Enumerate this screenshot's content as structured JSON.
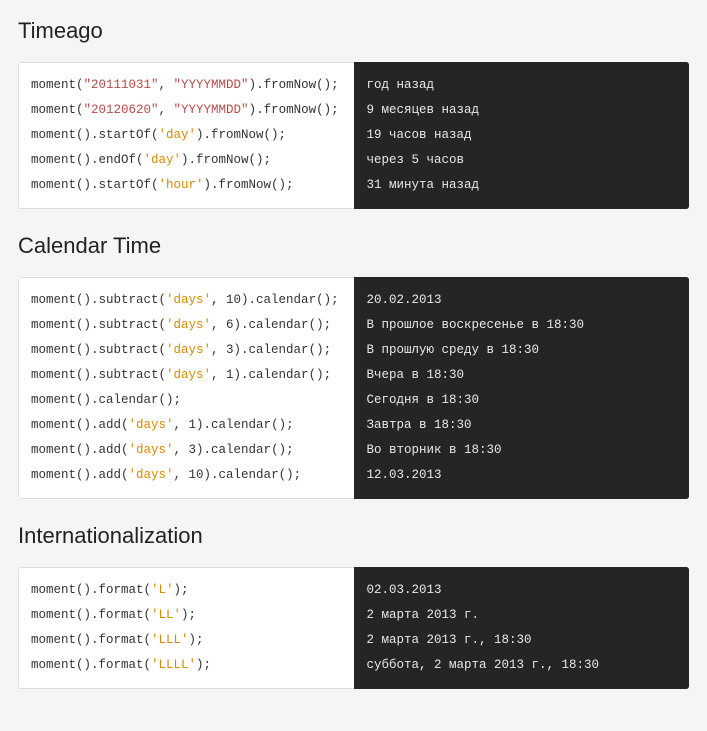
{
  "sections": [
    {
      "id": "timeago",
      "title": "Timeago",
      "rows": [
        {
          "code": [
            {
              "t": "plain",
              "v": "moment("
            },
            {
              "t": "str",
              "v": "\"20111031\""
            },
            {
              "t": "plain",
              "v": ", "
            },
            {
              "t": "str",
              "v": "\"YYYYMMDD\""
            },
            {
              "t": "plain",
              "v": ").fromNow();"
            }
          ],
          "out": "год назад"
        },
        {
          "code": [
            {
              "t": "plain",
              "v": "moment("
            },
            {
              "t": "str",
              "v": "\"20120620\""
            },
            {
              "t": "plain",
              "v": ", "
            },
            {
              "t": "str",
              "v": "\"YYYYMMDD\""
            },
            {
              "t": "plain",
              "v": ").fromNow();"
            }
          ],
          "out": "9 месяцев назад"
        },
        {
          "code": [
            {
              "t": "plain",
              "v": "moment().startOf("
            },
            {
              "t": "lit",
              "v": "'day'"
            },
            {
              "t": "plain",
              "v": ").fromNow();"
            }
          ],
          "out": "19 часов назад"
        },
        {
          "code": [
            {
              "t": "plain",
              "v": "moment().endOf("
            },
            {
              "t": "lit",
              "v": "'day'"
            },
            {
              "t": "plain",
              "v": ").fromNow();"
            }
          ],
          "out": "через 5 часов"
        },
        {
          "code": [
            {
              "t": "plain",
              "v": "moment().startOf("
            },
            {
              "t": "lit",
              "v": "'hour'"
            },
            {
              "t": "plain",
              "v": ").fromNow();"
            }
          ],
          "out": "31 минута назад"
        }
      ]
    },
    {
      "id": "calendar",
      "title": "Calendar Time",
      "rows": [
        {
          "code": [
            {
              "t": "plain",
              "v": "moment().subtract("
            },
            {
              "t": "lit",
              "v": "'days'"
            },
            {
              "t": "plain",
              "v": ", 10).calendar();"
            }
          ],
          "out": "20.02.2013"
        },
        {
          "code": [
            {
              "t": "plain",
              "v": "moment().subtract("
            },
            {
              "t": "lit",
              "v": "'days'"
            },
            {
              "t": "plain",
              "v": ", 6).calendar();"
            }
          ],
          "out": "В прошлое воскресенье в 18:30"
        },
        {
          "code": [
            {
              "t": "plain",
              "v": "moment().subtract("
            },
            {
              "t": "lit",
              "v": "'days'"
            },
            {
              "t": "plain",
              "v": ", 3).calendar();"
            }
          ],
          "out": "В прошлую среду в 18:30"
        },
        {
          "code": [
            {
              "t": "plain",
              "v": "moment().subtract("
            },
            {
              "t": "lit",
              "v": "'days'"
            },
            {
              "t": "plain",
              "v": ", 1).calendar();"
            }
          ],
          "out": "Вчера в 18:30"
        },
        {
          "code": [
            {
              "t": "plain",
              "v": "moment().calendar();"
            }
          ],
          "out": "Сегодня в 18:30"
        },
        {
          "code": [
            {
              "t": "plain",
              "v": "moment().add("
            },
            {
              "t": "lit",
              "v": "'days'"
            },
            {
              "t": "plain",
              "v": ", 1).calendar();"
            }
          ],
          "out": "Завтра в 18:30"
        },
        {
          "code": [
            {
              "t": "plain",
              "v": "moment().add("
            },
            {
              "t": "lit",
              "v": "'days'"
            },
            {
              "t": "plain",
              "v": ", 3).calendar();"
            }
          ],
          "out": "Во вторник в 18:30"
        },
        {
          "code": [
            {
              "t": "plain",
              "v": "moment().add("
            },
            {
              "t": "lit",
              "v": "'days'"
            },
            {
              "t": "plain",
              "v": ", 10).calendar();"
            }
          ],
          "out": "12.03.2013"
        }
      ]
    },
    {
      "id": "i18n",
      "title": "Internationalization",
      "rows": [
        {
          "code": [
            {
              "t": "plain",
              "v": "moment().format("
            },
            {
              "t": "lit",
              "v": "'L'"
            },
            {
              "t": "plain",
              "v": ");"
            }
          ],
          "out": "02.03.2013"
        },
        {
          "code": [
            {
              "t": "plain",
              "v": "moment().format("
            },
            {
              "t": "lit",
              "v": "'LL'"
            },
            {
              "t": "plain",
              "v": ");"
            }
          ],
          "out": "2 марта 2013 г."
        },
        {
          "code": [
            {
              "t": "plain",
              "v": "moment().format("
            },
            {
              "t": "lit",
              "v": "'LLL'"
            },
            {
              "t": "plain",
              "v": ");"
            }
          ],
          "out": "2 марта 2013 г., 18:30"
        },
        {
          "code": [
            {
              "t": "plain",
              "v": "moment().format("
            },
            {
              "t": "lit",
              "v": "'LLLL'"
            },
            {
              "t": "plain",
              "v": ");"
            }
          ],
          "out": "суббота, 2 марта 2013 г., 18:30"
        }
      ]
    }
  ]
}
